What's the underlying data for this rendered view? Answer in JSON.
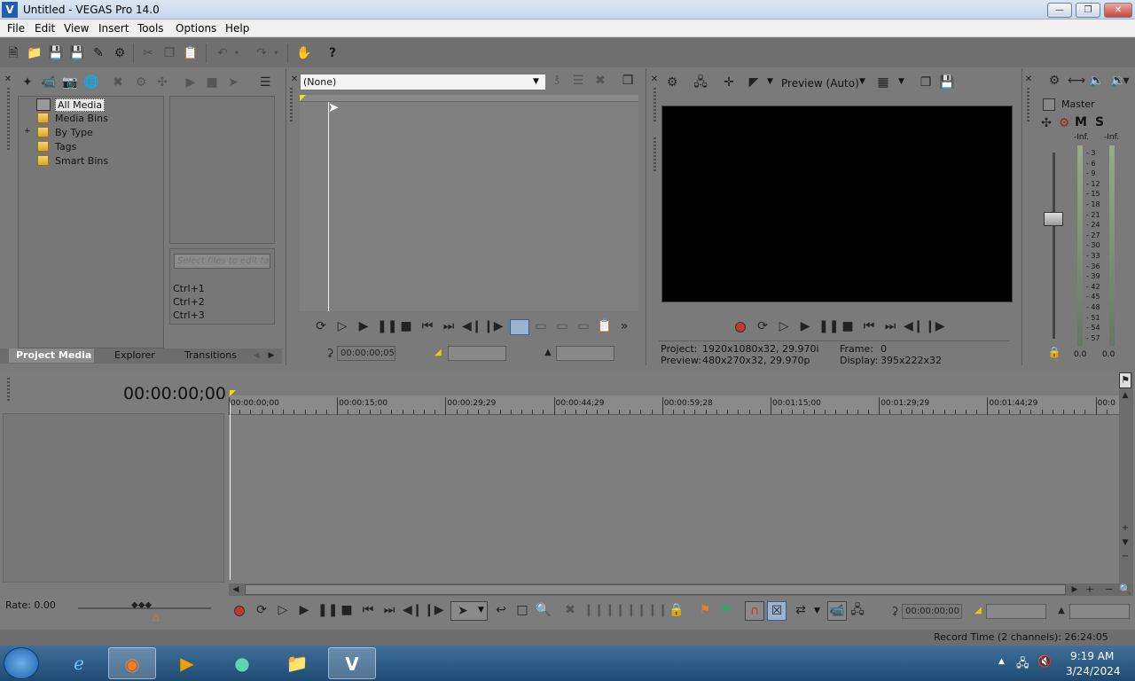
{
  "window": {
    "title": "Untitled - VEGAS Pro 14.0",
    "logo": "V"
  },
  "menu": [
    "File",
    "Edit",
    "View",
    "Insert",
    "Tools",
    "Options",
    "Help"
  ],
  "media": {
    "tree": [
      {
        "label": "All Media"
      },
      {
        "label": "Media Bins"
      },
      {
        "label": "By Type",
        "expander": "+"
      },
      {
        "label": "Tags"
      },
      {
        "label": "Smart Bins"
      }
    ],
    "tag_placeholder": "Select files to edit tag...",
    "shortcuts": [
      "Ctrl+1",
      "Ctrl+2",
      "Ctrl+3"
    ],
    "tabs": [
      "Project Media",
      "Explorer",
      "Transitions"
    ]
  },
  "trimmer": {
    "dropdown_value": "(None)",
    "timecode": "00:00:00;05"
  },
  "preview": {
    "quality": "Preview (Auto)",
    "project_label": "Project:",
    "project_value": "1920x1080x32, 29.970i",
    "preview_label": "Preview:",
    "preview_value": "480x270x32, 29.970p",
    "frame_label": "Frame:",
    "frame_value": "0",
    "display_label": "Display:",
    "display_value": "395x222x32"
  },
  "mixer": {
    "master": "Master",
    "m": "M",
    "s": "S",
    "inf_left": "-Inf.",
    "inf_right": "-Inf.",
    "scale": [
      "3",
      "6",
      "9",
      "12",
      "15",
      "18",
      "21",
      "24",
      "27",
      "30",
      "33",
      "36",
      "39",
      "42",
      "45",
      "48",
      "51",
      "54",
      "57"
    ],
    "bottom_left": "0.0",
    "bottom_right": "0.0"
  },
  "timeline": {
    "cursor_time": "00:00:00;00",
    "ruler": [
      "00:00:00;00",
      "00:00:15;00",
      "00:00:29;29",
      "00:00:44;29",
      "00:00:59;28",
      "00:01:15;00",
      "00:01:29;29",
      "00:01:44;29",
      "00:0"
    ],
    "rate": "Rate: 0.00",
    "transport_timecode": "00:00:00;00"
  },
  "status": {
    "record_time": "Record Time (2 channels): 26:24:05"
  },
  "taskbar": {
    "time": "9:19 AM",
    "date": "3/24/2024"
  },
  "colors": {
    "accent": "#1f5fae",
    "panel_bg": "#7a7a7a",
    "record_red": "#c0392b"
  }
}
